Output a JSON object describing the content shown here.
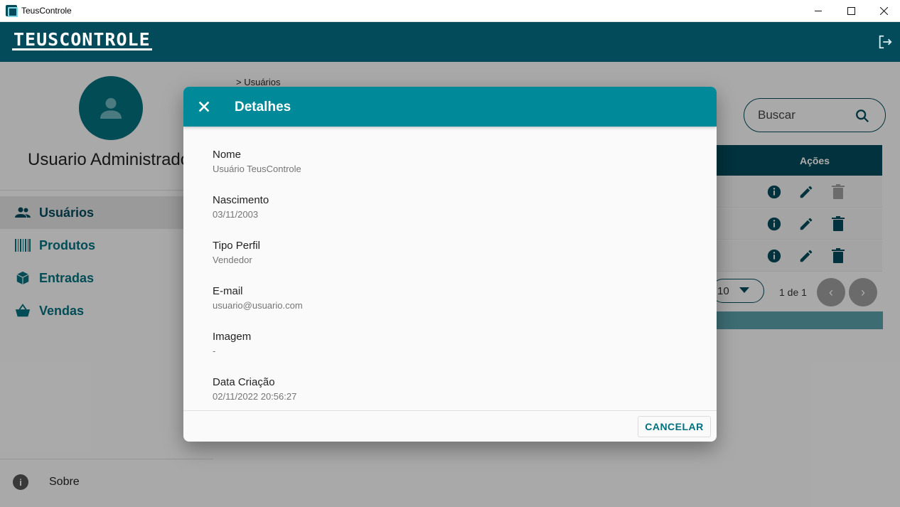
{
  "window": {
    "title": "TeusControle",
    "controls": [
      "minimize-icon",
      "maximize-icon",
      "close-icon"
    ]
  },
  "header": {
    "logo_text": "TEUSCONTROLE",
    "logout_icon": "logout-icon",
    "color": "#034b5a"
  },
  "sidebar": {
    "avatar_icon": "person-icon",
    "user_name": "Usuario Administrador",
    "items": [
      {
        "label": "Usuários",
        "icon": "users-icon",
        "active": true
      },
      {
        "label": "Produtos",
        "icon": "barcode-icon",
        "active": false
      },
      {
        "label": "Entradas",
        "icon": "box-icon",
        "active": false
      },
      {
        "label": "Vendas",
        "icon": "basket-icon",
        "active": false
      }
    ],
    "about_label": "Sobre"
  },
  "main": {
    "breadcrumb": "> Usuários",
    "search_placeholder": "Buscar",
    "table": {
      "actions_header": "Ações",
      "row_count": 3,
      "row_actions": [
        "info-icon",
        "edit-icon",
        "delete-icon"
      ]
    },
    "pagination": {
      "rows_per_page": "10",
      "page_info": "1 de 1",
      "prev": "‹",
      "next": "›"
    }
  },
  "dialog": {
    "title": "Detalhes",
    "fields": [
      {
        "label": "Nome",
        "value": "Usuário TeusControle"
      },
      {
        "label": "Nascimento",
        "value": "03/11/2003"
      },
      {
        "label": "Tipo Perfil",
        "value": "Vendedor"
      },
      {
        "label": "E-mail",
        "value": "usuario@usuario.com"
      },
      {
        "label": "Imagem",
        "value": "-"
      },
      {
        "label": "Data Criação",
        "value": "02/11/2022 20:56:27"
      }
    ],
    "cancel_label": "CANCELAR",
    "header_color": "#008a99"
  }
}
